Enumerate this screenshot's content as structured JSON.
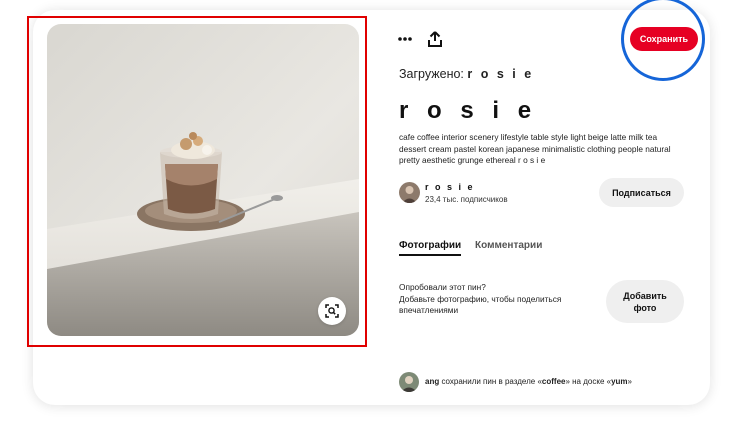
{
  "pin": {
    "image_alt": "coffee dessert on saucer",
    "uploaded_label": "Загружено:",
    "uploaded_by": "r o s i e",
    "title": "r o s i e",
    "description": "cafe coffee interior scenery lifestyle table style light beige latte milk tea dessert cream pastel korean japanese minimalistic clothing people natural pretty aesthetic grunge ethereal r o s i e"
  },
  "toolbar": {
    "more_icon": "more-icon",
    "share_icon": "share-icon",
    "save_label": "Сохранить"
  },
  "creator": {
    "name": "r o s i e",
    "followers": "23,4 тыс. подписчиков",
    "follow_label": "Подписаться"
  },
  "tabs": [
    {
      "label": "Фотографии",
      "active": true
    },
    {
      "label": "Комментарии",
      "active": false
    }
  ],
  "tried": {
    "line1": "Опробовали этот пин?",
    "line2": "Добавьте фотографию, чтобы поделиться впечатлениями",
    "add_photo_label_1": "Добавить",
    "add_photo_label_2": "фото"
  },
  "activity": {
    "user": "ang",
    "text_1": " сохранили пин в разделе «",
    "section": "coffee",
    "text_2": "» на доске «",
    "board": "yum",
    "text_3": "»"
  },
  "colors": {
    "save_button": "#e60023",
    "highlight_rect": "#e00000",
    "highlight_circle": "#1565d8"
  }
}
